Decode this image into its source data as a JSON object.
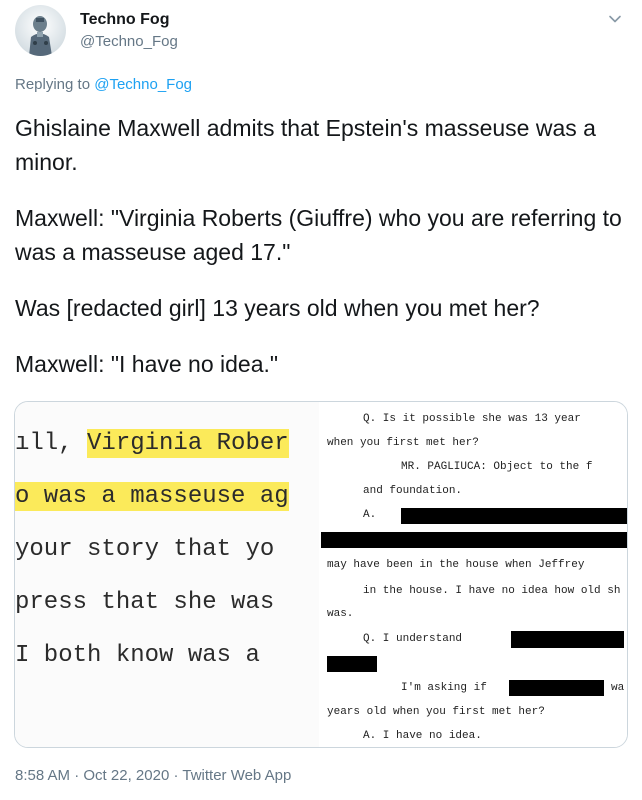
{
  "user": {
    "display_name": "Techno Fog",
    "handle": "@Techno_Fog"
  },
  "reply": {
    "prefix": "Replying to ",
    "mention": "@Techno_Fog"
  },
  "tweet": {
    "paragraphs": [
      "Ghislaine Maxwell admits that Epstein's masseuse was a minor.",
      "Maxwell: \"Virginia Roberts (Giuffre) who you are referring to was a masseuse aged 17.\"",
      "Was [redacted girl] 13 years old when you met her?",
      "Maxwell: \"I have no idea.\""
    ]
  },
  "media": {
    "left_excerpt": {
      "line1_a": "ıll, ",
      "line1_b": "Virginia Rober",
      "line2": "o was a masseuse ag",
      "line3": " your story that yo",
      "line4": "press that she was ",
      "line5": " I both know was a "
    },
    "right_excerpt": {
      "l1": "Q.   Is it possible she was 13 year",
      "l2": "when you first met her?",
      "l3": "MR. PAGLIUCA:  Object to the f",
      "l4": "and foundation.",
      "l5": "A.",
      "l6": "may have been in the house when Jeffrey",
      "l7": "in the house.  I have no idea how old sh",
      "l8": "was.",
      "l9": "Q.   I understand",
      "l10": "I'm asking if",
      "l10b": "wa",
      "l11": "years old when you first met her?",
      "l12": "A.   I have no idea."
    },
    "highlight_color": "#fbea5a"
  },
  "meta": {
    "time": "8:58 AM",
    "sep1": " · ",
    "date": "Oct 22, 2020",
    "sep2": " · ",
    "source": "Twitter Web App"
  },
  "colors": {
    "link": "#1da1f2",
    "secondary_text": "#657786",
    "primary_text": "#14171a",
    "border": "#ccd6dd"
  },
  "icons": {
    "avatar": "robot-avatar",
    "caret": "chevron-down-icon"
  }
}
